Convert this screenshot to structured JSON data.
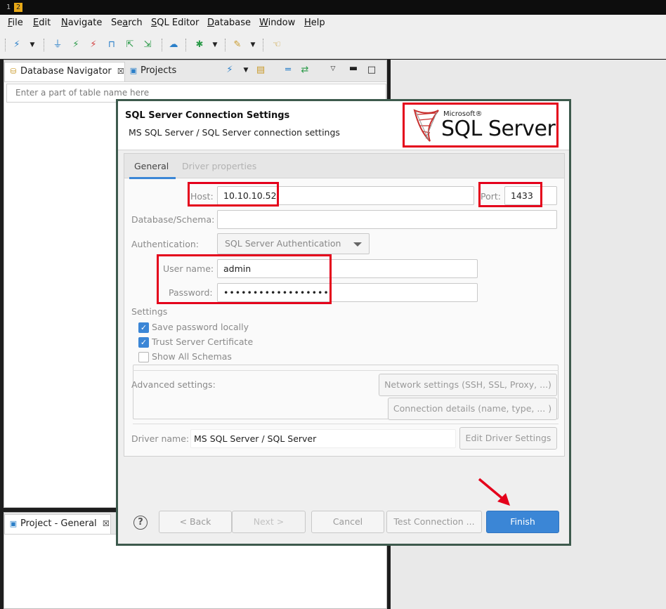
{
  "workspace_tags": [
    "1",
    "2"
  ],
  "menu": {
    "items": [
      "File",
      "Edit",
      "Navigate",
      "Search",
      "SQL Editor",
      "Database",
      "Window",
      "Help"
    ],
    "underline": [
      "F",
      "E",
      "N",
      "a",
      "S",
      "D",
      "W",
      "H"
    ]
  },
  "navigator": {
    "tab_label": "Database Navigator",
    "close_glyph": "☒",
    "projects_tab_label": "Projects",
    "filter_placeholder": "Enter a part of table name here"
  },
  "project_panel": {
    "tab_label": "Project - General",
    "close_glyph": "☒"
  },
  "dialog": {
    "title": "SQL Server Connection Settings",
    "subtitle": "MS SQL Server / SQL Server connection settings",
    "logo": {
      "brand": "Microsoft®",
      "product": "SQL Server"
    },
    "tabs": [
      "General",
      "Driver properties"
    ],
    "host": {
      "label": "Host:",
      "value": "10.10.10.52"
    },
    "port": {
      "label": "Port:",
      "value": "1433"
    },
    "database": {
      "label": "Database/Schema:",
      "value": ""
    },
    "authentication": {
      "label": "Authentication:",
      "value": "SQL Server Authentication"
    },
    "username": {
      "label": "User name:",
      "value": "admin"
    },
    "password": {
      "label": "Password:",
      "value": "••••••••••••••••••"
    },
    "settings": {
      "title": "Settings",
      "options": [
        {
          "label": "Save password locally",
          "checked": true
        },
        {
          "label": "Trust Server Certificate",
          "checked": true
        },
        {
          "label": "Show All Schemas",
          "checked": false
        }
      ]
    },
    "advanced_label": "Advanced settings:",
    "network_button": "Network settings (SSH, SSL, Proxy, ...)",
    "connection_details_button": "Connection details (name, type, ... )",
    "driver_name": {
      "label": "Driver name:",
      "value": "MS SQL Server / SQL Server"
    },
    "edit_driver_button": "Edit Driver Settings",
    "buttons": {
      "help": "?",
      "back": "< Back",
      "next": "Next >",
      "cancel": "Cancel",
      "test": "Test Connection ...",
      "finish": "Finish"
    }
  },
  "colors": {
    "highlight": "#e4001b",
    "accent": "#3b86d6",
    "dialog_border": "#3d5a4d"
  }
}
